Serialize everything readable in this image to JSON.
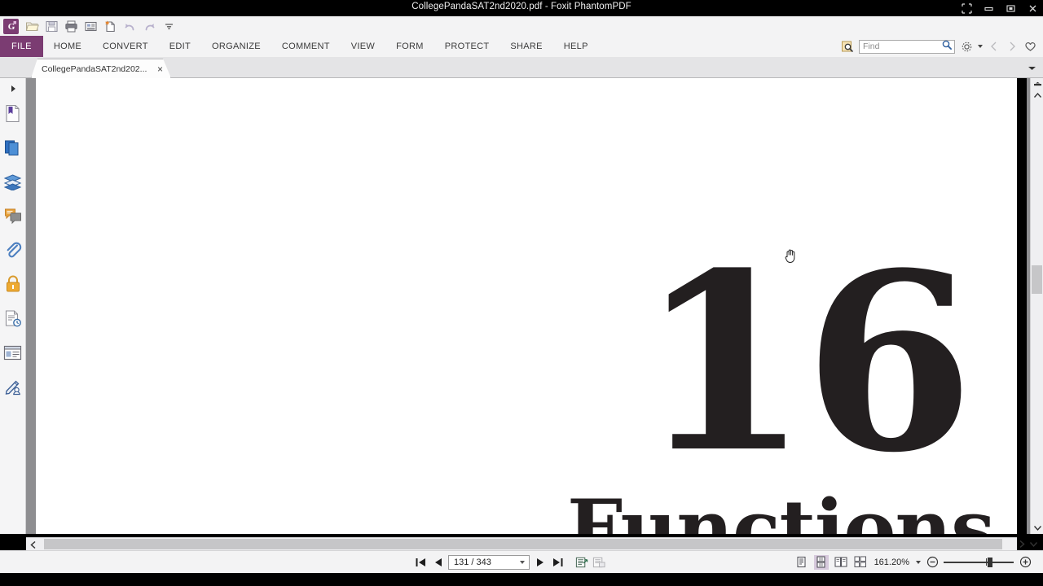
{
  "window": {
    "title": "CollegePandaSAT2nd2020.pdf - Foxit PhantomPDF",
    "controls": [
      {
        "name": "restore-down-icon",
        "glyph": "fullscreen"
      },
      {
        "name": "minimize-icon",
        "glyph": "minimize"
      },
      {
        "name": "maximize-icon",
        "glyph": "maximize"
      },
      {
        "name": "close-icon",
        "glyph": "close"
      }
    ]
  },
  "quick_access": {
    "items": [
      {
        "name": "foxit-logo-icon",
        "label": "Foxit"
      },
      {
        "name": "open-file-icon",
        "label": "Open"
      },
      {
        "name": "save-icon",
        "label": "Save"
      },
      {
        "name": "print-icon",
        "label": "Print"
      },
      {
        "name": "email-icon",
        "label": "Email"
      },
      {
        "name": "new-from-scanner-icon",
        "label": "New"
      },
      {
        "name": "undo-icon",
        "label": "Undo"
      },
      {
        "name": "redo-icon",
        "label": "Redo"
      },
      {
        "name": "customize-toolbar-icon",
        "label": "Customize"
      }
    ]
  },
  "ribbon": {
    "file_tab": "FILE",
    "tabs": [
      {
        "label": "HOME"
      },
      {
        "label": "CONVERT"
      },
      {
        "label": "EDIT"
      },
      {
        "label": "ORGANIZE"
      },
      {
        "label": "COMMENT"
      },
      {
        "label": "VIEW"
      },
      {
        "label": "FORM"
      },
      {
        "label": "PROTECT"
      },
      {
        "label": "SHARE"
      },
      {
        "label": "HELP"
      }
    ],
    "accent_color": "#7b3c72",
    "search": {
      "placeholder": "Find",
      "value": ""
    },
    "right_icons": [
      {
        "name": "advanced-search-icon"
      },
      {
        "name": "settings-gear-icon"
      },
      {
        "name": "navigate-back-icon"
      },
      {
        "name": "navigate-forward-icon"
      },
      {
        "name": "favorites-heart-icon"
      }
    ]
  },
  "doc_tabs": {
    "active": {
      "label": "CollegePandaSAT2nd202...",
      "close": "×"
    }
  },
  "left_panel": {
    "items": [
      {
        "name": "panel-expand-icon",
        "label": "Expand Panel"
      },
      {
        "name": "bookmarks-icon",
        "label": "Bookmarks"
      },
      {
        "name": "pages-icon",
        "label": "Pages"
      },
      {
        "name": "layers-icon",
        "label": "Layers"
      },
      {
        "name": "comments-icon",
        "label": "Comments"
      },
      {
        "name": "attachments-icon",
        "label": "Attachments"
      },
      {
        "name": "security-lock-icon",
        "label": "Security"
      },
      {
        "name": "stamps-icon",
        "label": "Stamps"
      },
      {
        "name": "fields-icon",
        "label": "Fields"
      },
      {
        "name": "digital-signature-icon",
        "label": "Digital Signatures"
      }
    ]
  },
  "document": {
    "chapter_number": "16",
    "chapter_title": "Functions",
    "cursor": "hand-cursor"
  },
  "status_bar": {
    "first_page_label": "First Page",
    "prev_page_label": "Previous Page",
    "page_value": "131 / 343",
    "current_page": 131,
    "total_pages": 343,
    "next_page_label": "Next Page",
    "last_page_label": "Last Page",
    "extra_icons": [
      {
        "name": "page-transition-icon"
      },
      {
        "name": "page-display-icon"
      }
    ],
    "view_modes": [
      {
        "name": "single-page-view-icon",
        "active": false
      },
      {
        "name": "continuous-scroll-view-icon",
        "active": true
      },
      {
        "name": "facing-page-view-icon",
        "active": false
      },
      {
        "name": "continuous-facing-view-icon",
        "active": false
      }
    ],
    "zoom_value": "161.20%",
    "zoom_out_label": "Zoom Out",
    "zoom_in_label": "Zoom In"
  }
}
